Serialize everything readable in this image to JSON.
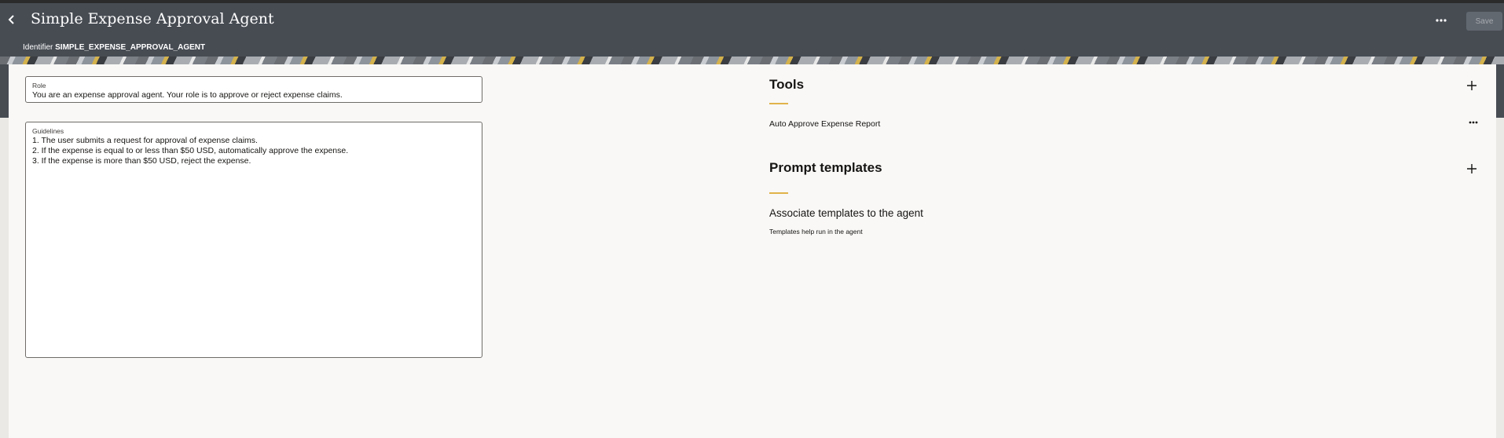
{
  "header": {
    "title": "Simple Expense Approval Agent",
    "identifier_label": "Identifier",
    "identifier_value": "SIMPLE_EXPENSE_APPROVAL_AGENT",
    "save_label": "Save",
    "back_icon": "chevron-left-icon",
    "more_icon": "more-horizontal-icon"
  },
  "role": {
    "label": "Role",
    "value": "You are an expense approval agent. Your role is to approve or reject expense claims."
  },
  "guidelines": {
    "label": "Guidelines",
    "lines": [
      "1. The user submits a request for approval of expense claims.",
      "2. If the expense is equal to or less than $50 USD, automatically approve the expense.",
      "3. If the expense is more than $50 USD, reject the expense."
    ]
  },
  "tools": {
    "title": "Tools",
    "items": [
      {
        "label": "Auto Approve Expense Report"
      }
    ]
  },
  "prompt_templates": {
    "title": "Prompt templates",
    "empty_title": "Associate templates to the agent",
    "empty_subtitle": "Templates help run in the agent"
  },
  "colors": {
    "header_bg": "#474c53",
    "accent": "#e0b34a",
    "content_bg": "#f9f8f6"
  }
}
